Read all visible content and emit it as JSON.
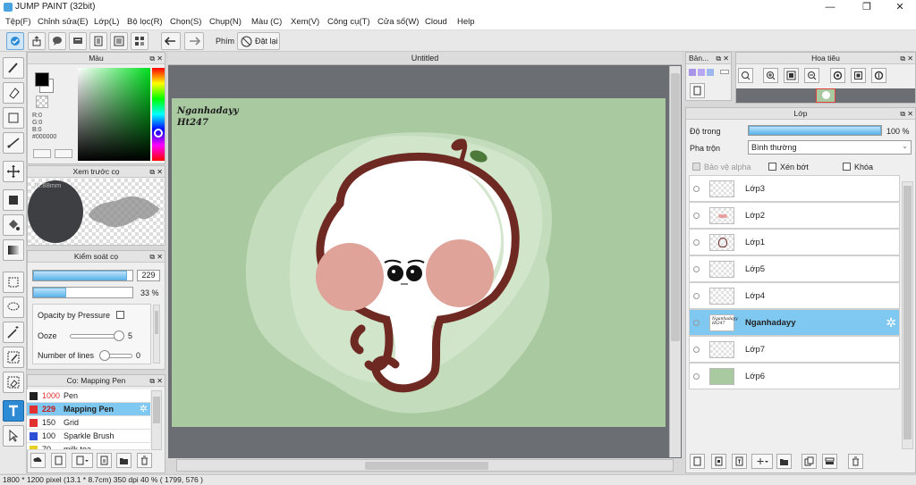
{
  "app": {
    "title": "JUMP PAINT (32bit)",
    "window_controls": {
      "minimize": "—",
      "maximize": "❐",
      "close": "✕"
    }
  },
  "menu": [
    "Tệp(F)",
    "Chỉnh sửa(E)",
    "Lớp(L)",
    "Bộ lọc(R)",
    "Chọn(S)",
    "Chụp(N)",
    "Màu (C)",
    "Xem(V)",
    "Công cụ(T)",
    "Cửa sổ(W)",
    "Cloud",
    "Help"
  ],
  "toolbar": {
    "phim_label": "Phím",
    "reset_label": "Đặt lại"
  },
  "color_panel": {
    "title": "Màu",
    "r": "R:0",
    "g": "G:0",
    "b": "B:0",
    "hex": "#000000",
    "current_color": "#000000"
  },
  "brush_preview": {
    "title": "Xem trước cọ",
    "size_label": "16.88mm"
  },
  "brush_control": {
    "title": "Kiểm soát cọ",
    "size_value": "229",
    "opacity_value": "33 %",
    "opacity_fraction": 0.33,
    "size_fraction": 0.95,
    "opacity_by_pressure": "Opacity by Pressure",
    "ooze_label": "Ooze",
    "ooze_value": "5",
    "lines_label": "Number of lines",
    "lines_value": "0"
  },
  "brush_list": {
    "title": "Cọ: Mapping Pen",
    "items": [
      {
        "size": "1000",
        "name": "Pen",
        "color": "#222222"
      },
      {
        "size": "229",
        "name": "Mapping Pen",
        "color": "#e03030"
      },
      {
        "size": "150",
        "name": "Grid",
        "color": "#e03030"
      },
      {
        "size": "100",
        "name": "Sparkle Brush",
        "color": "#2d4fd6"
      },
      {
        "size": "70",
        "name": "milk tea",
        "color": "#e8d020"
      }
    ]
  },
  "canvas": {
    "tab_title": "Untitled",
    "watermark_line1": "Nganhadayy",
    "watermark_line2": "Ht247",
    "background_color": "#a9c9a0"
  },
  "status": {
    "text": "1800 * 1200 pixel   (13.1 * 8.7cm)   350 dpi   40 %   ( 1799, 576 )"
  },
  "bando": {
    "title": "Bản..."
  },
  "navigator": {
    "title": "Hoa tiêu"
  },
  "layers_panel": {
    "title": "Lớp",
    "opacity_label": "Độ trong",
    "opacity_value": "100 %",
    "opacity_fraction": 1.0,
    "blend_label": "Pha trộn",
    "blend_value": "Bình thường",
    "protect_alpha": "Bảo vệ alpha",
    "clipping": "Xén bớt",
    "lock": "Khóa",
    "layers": [
      {
        "name": "Lớp3"
      },
      {
        "name": "Lớp2"
      },
      {
        "name": "Lớp1"
      },
      {
        "name": "Lớp5"
      },
      {
        "name": "Lớp4"
      },
      {
        "name": "Nganhadayy",
        "thumb_line1": "Nganhadayy",
        "thumb_line2": "Ht247"
      },
      {
        "name": "Lớp7"
      },
      {
        "name": "Lớp6"
      }
    ]
  },
  "colors": {
    "accent": "#2d8bd6",
    "selection": "#7ec8f2",
    "canvas_bg": "#6b6e72"
  }
}
